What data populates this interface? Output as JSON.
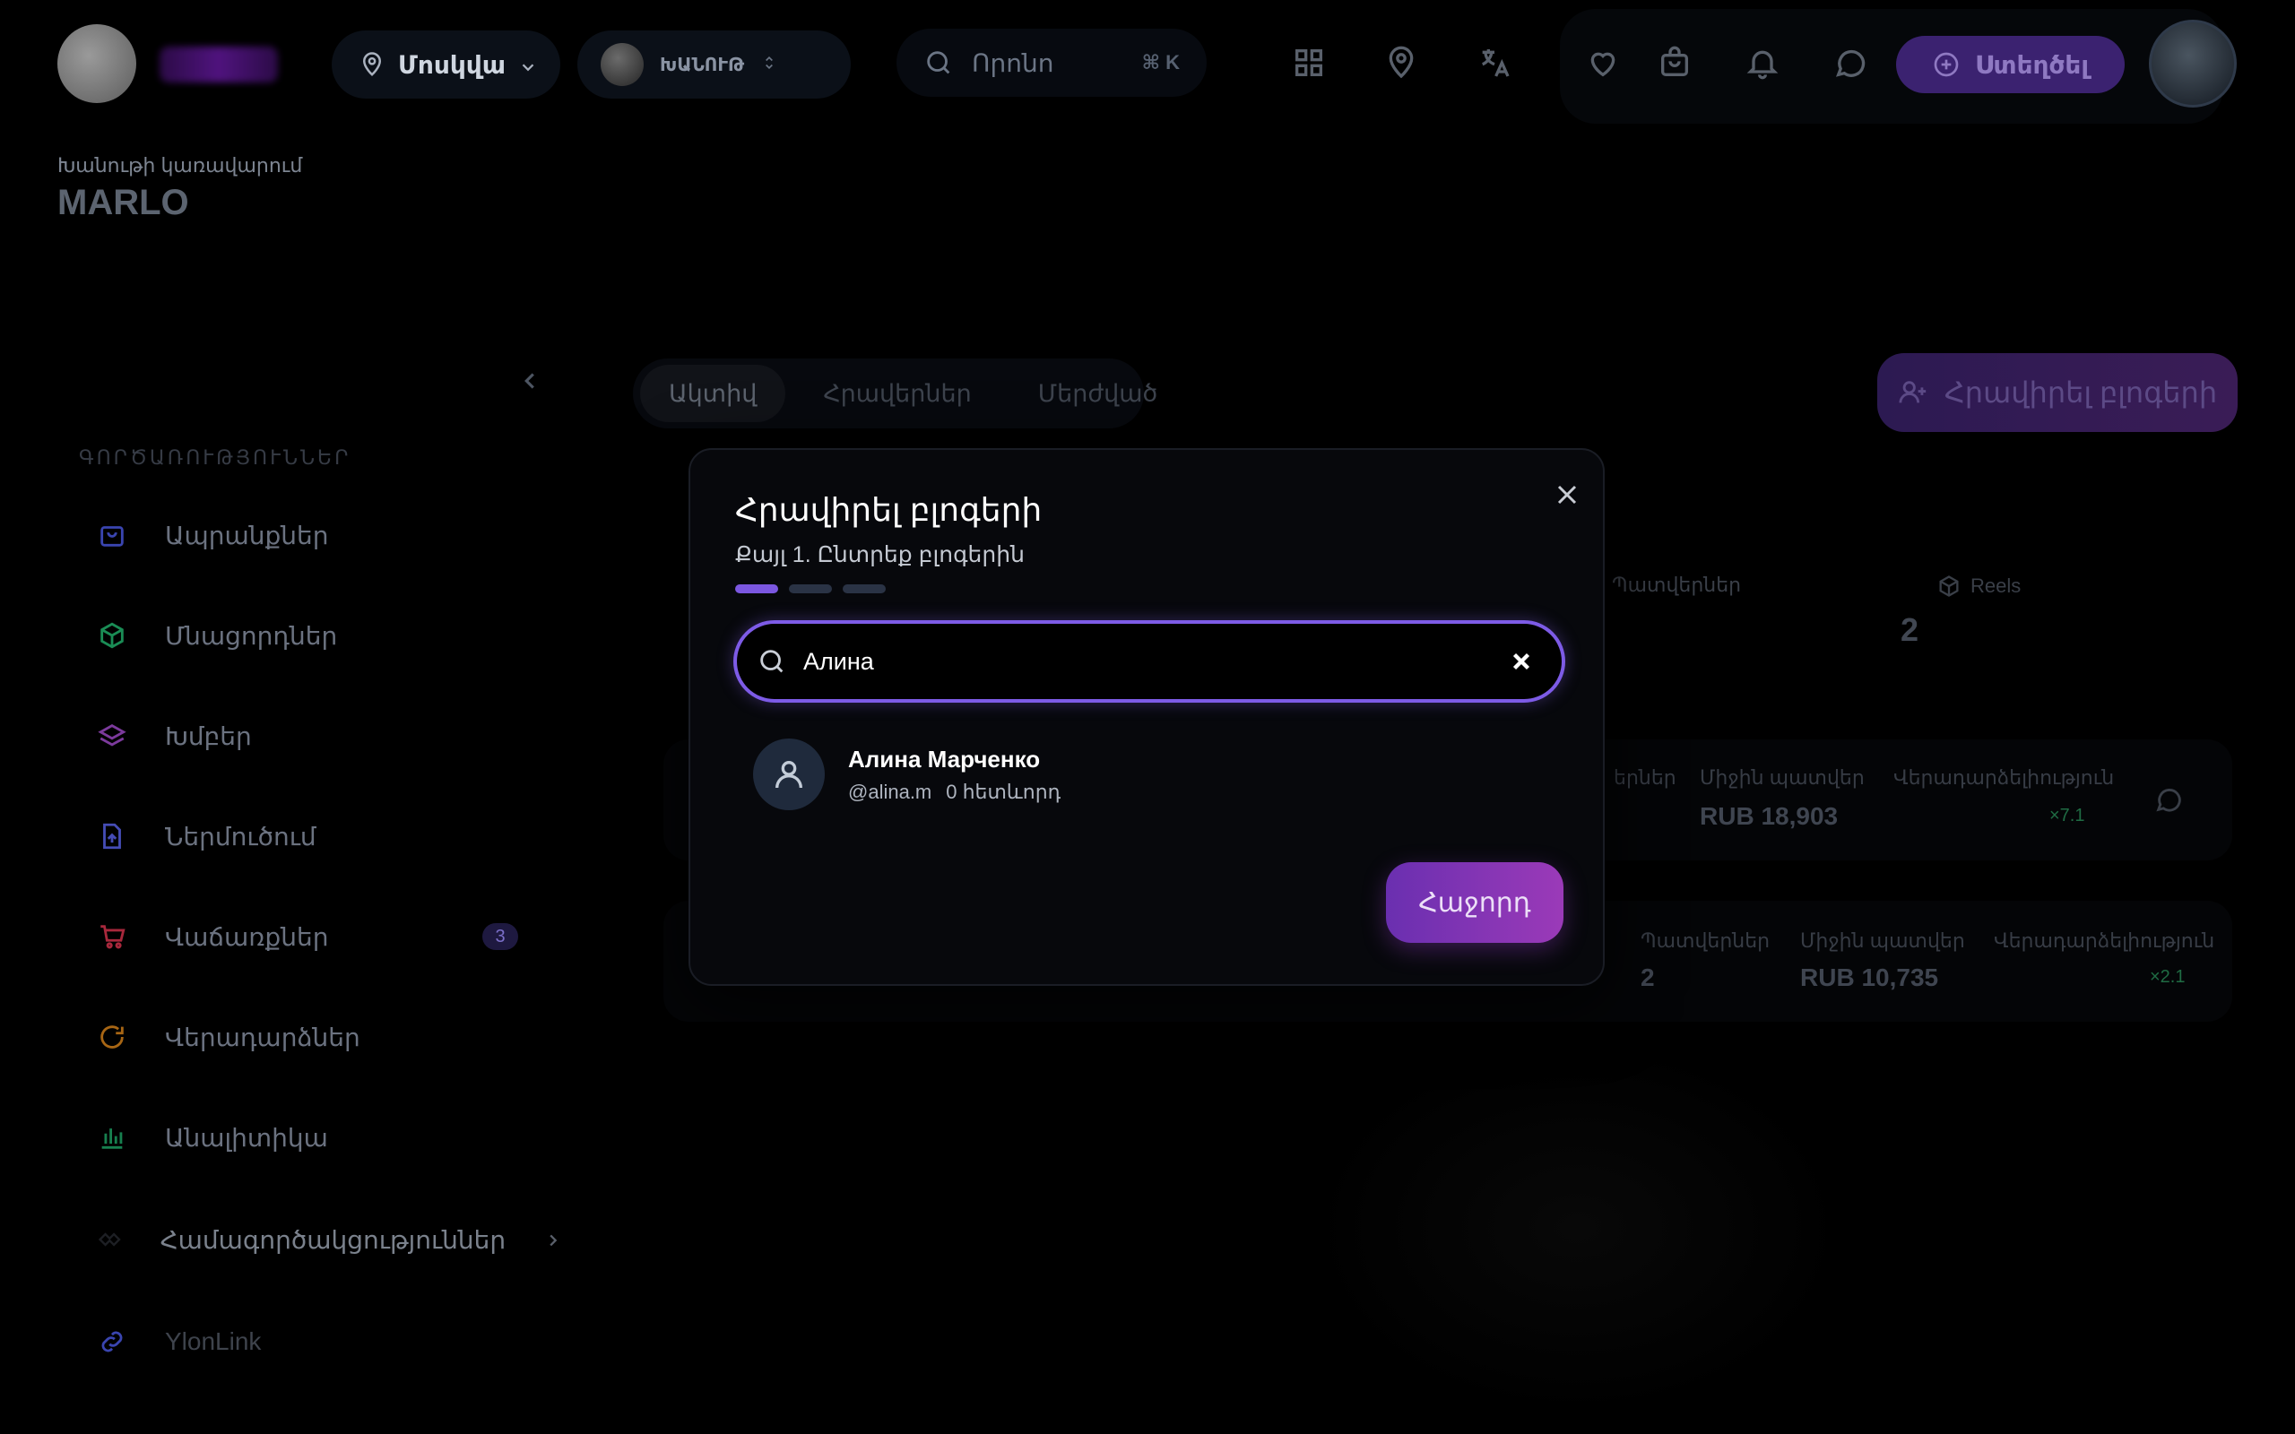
{
  "header": {
    "city": "Մոսկվա",
    "shop": "ԽԱՆՈՒԹ",
    "search_placeholder": "Որոնո",
    "search_shortcut": "⌘ K",
    "create_label": "Ստեղծել"
  },
  "page": {
    "subtitle": "Խանութի կառավարում",
    "title": "MARLO"
  },
  "sidebar": {
    "section": "ԳՈՐԾԱՌՈՒԹՅՈՒՆՆԵՐ",
    "items": [
      {
        "label": "Ապրանքներ",
        "icon": "bag-icon",
        "color": "#4a56d6"
      },
      {
        "label": "Մնացորդներ",
        "icon": "box-icon",
        "color": "#22b36a"
      },
      {
        "label": "Խմբեր",
        "icon": "layers-icon",
        "color": "#a84bd0"
      },
      {
        "label": "Ներմուծում",
        "icon": "file-upload-icon",
        "color": "#5a62e0"
      },
      {
        "label": "Վաճառքներ",
        "icon": "cart-icon",
        "color": "#e0334d",
        "badge": "3"
      },
      {
        "label": "Վերադարձներ",
        "icon": "refresh-icon",
        "color": "#e08a1a"
      },
      {
        "label": "Անալիտիկա",
        "icon": "bar-chart-icon",
        "color": "#1fa868"
      },
      {
        "label": "Համագործակցություններ",
        "icon": "handshake-icon",
        "color": "#333"
      },
      {
        "label": "YlonLink",
        "icon": "link-icon",
        "color": "#4a56d6"
      }
    ]
  },
  "tabs": [
    "Ակտիվ",
    "Հրավերներ",
    "Մերժված"
  ],
  "invite_button": "Հրավիրել բլոգերի",
  "stats": {
    "orders_label": "Պատվերներ",
    "reels_label": "Reels",
    "reels_value": "2"
  },
  "rows": [
    {
      "col1_label": "երներ",
      "avg_label": "Միջին պատվեր",
      "avg_value": "RUB 18,903",
      "return_label": "Վերադարձելիություն",
      "multiplier": "×7.1"
    },
    {
      "orders_label": "Պատվերներ",
      "orders_value": "2",
      "avg_label": "Միջին պատվեր",
      "avg_value": "RUB 10,735",
      "return_label": "Վերադարձելիություն",
      "multiplier": "×2.1"
    }
  ],
  "modal": {
    "title": "Հրավիրել բլոգերի",
    "step": "Քայլ 1. Ընտրեք բլոգերին",
    "search_value": "Алина",
    "result": {
      "name": "Алина Марченко",
      "handle": "@alina.m",
      "followers": "0 հետևորդ"
    },
    "next_label": "Հաջորդ"
  }
}
